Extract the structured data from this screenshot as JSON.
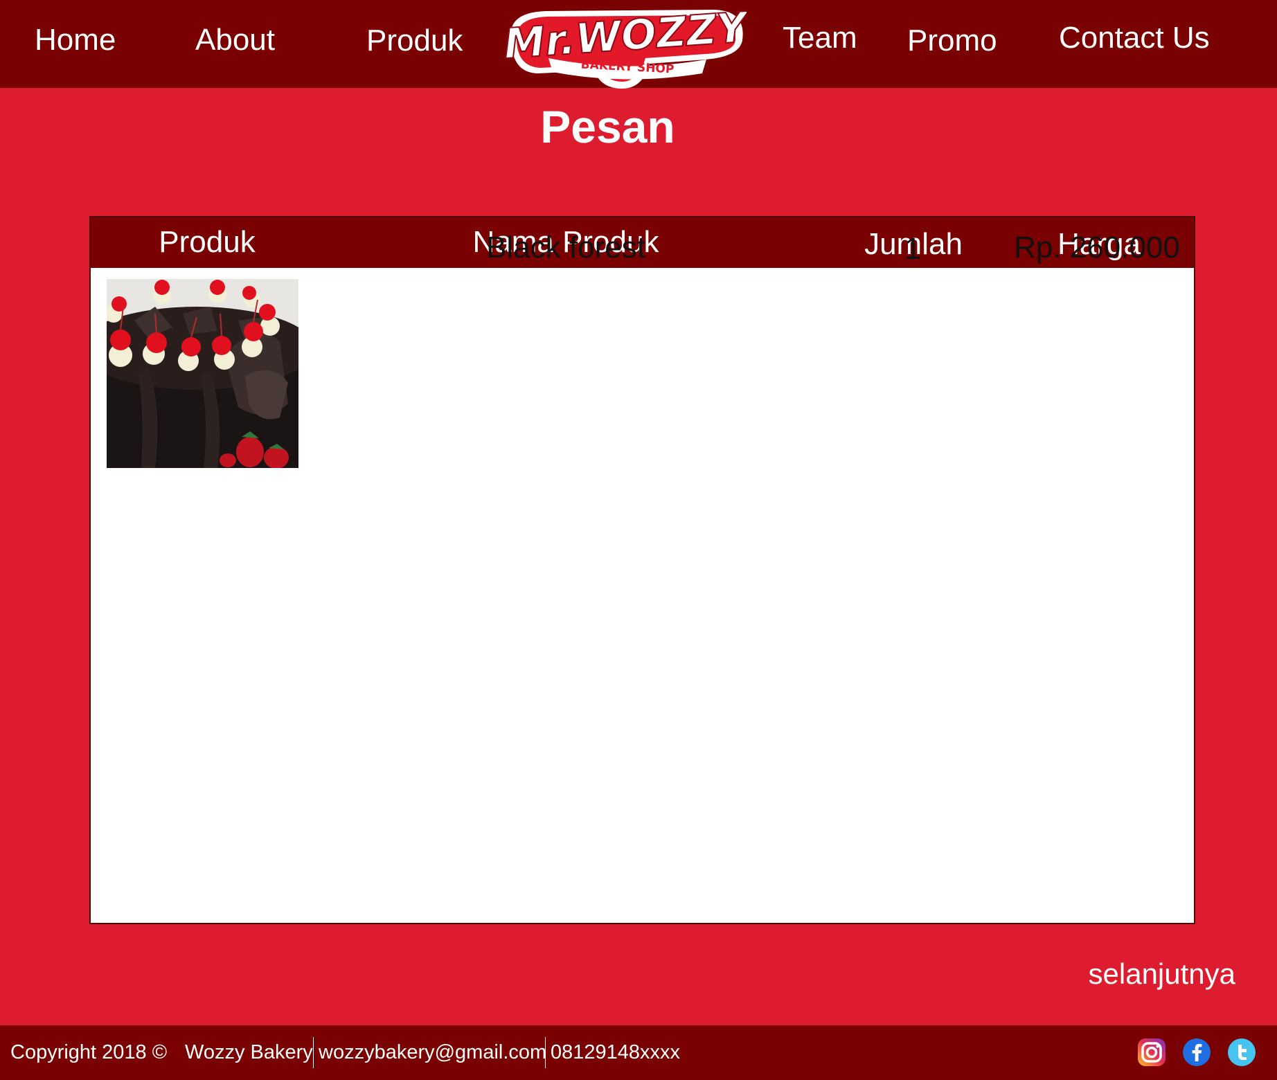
{
  "nav": {
    "home": "Home",
    "about": "About",
    "produk": "Produk",
    "team": "Team",
    "promo": "Promo",
    "contact": "Contact Us"
  },
  "logo": {
    "brand": "Mr.WOZZY",
    "tagline": "BAKERY SHOP"
  },
  "page": {
    "title": "Pesan"
  },
  "table": {
    "headers": [
      "Produk",
      "Nama Produk",
      "Jumlah",
      "Harga"
    ],
    "rows": [
      {
        "image": "black-forest-cake-photo",
        "name": "Black forest",
        "qty": "1",
        "price": "Rp. 260.000"
      }
    ]
  },
  "next_link": "selanjutnya",
  "footer": {
    "copyright": "Copyright 2018 ©",
    "company": "Wozzy Bakery",
    "email": "wozzybakery@gmail.com",
    "phone": "08129148xxxx",
    "social": [
      "instagram-icon",
      "facebook-icon",
      "twitter-icon"
    ]
  },
  "colors": {
    "nav_bg": "#7a0102",
    "page_bg": "#dd1c2f",
    "text_light": "#ffffff"
  }
}
